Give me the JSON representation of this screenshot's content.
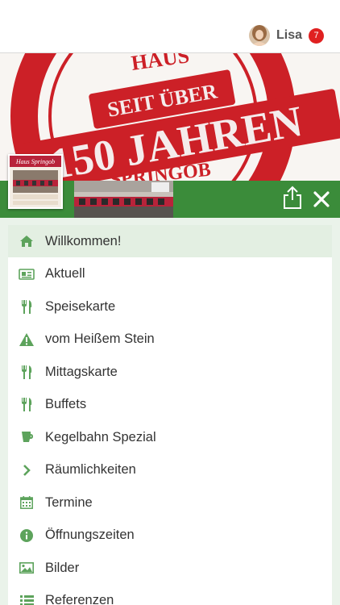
{
  "user": {
    "name": "Lisa",
    "notifications": "7"
  },
  "banner": {
    "line1": "SEIT ÜBER",
    "line2": "150 JAHREN",
    "top_text": "HAUS",
    "bottom_text": "SPRINGOB"
  },
  "logo": {
    "title": "Haus Springob",
    "caption": "Gemütlich, Alles im Spektakel mit Kegelbahn",
    "footer": "Haus Springob - seit über 150 Jahren"
  },
  "menu": {
    "items": [
      {
        "label": "Willkommen!",
        "icon": "home-icon",
        "active": true
      },
      {
        "label": "Aktuell",
        "icon": "newspaper-icon",
        "active": false
      },
      {
        "label": "Speisekarte",
        "icon": "cutlery-icon",
        "active": false
      },
      {
        "label": "vom Heißem Stein",
        "icon": "warning-icon",
        "active": false
      },
      {
        "label": "Mittagskarte",
        "icon": "cutlery-icon",
        "active": false
      },
      {
        "label": "Buffets",
        "icon": "cutlery-icon",
        "active": false
      },
      {
        "label": "Kegelbahn Spezial",
        "icon": "coffee-icon",
        "active": false
      },
      {
        "label": "Räumlichkeiten",
        "icon": "chevron-right-icon",
        "active": false
      },
      {
        "label": "Termine",
        "icon": "calendar-icon",
        "active": false
      },
      {
        "label": "Öffnungszeiten",
        "icon": "info-icon",
        "active": false
      },
      {
        "label": "Bilder",
        "icon": "image-icon",
        "active": false
      },
      {
        "label": "Referenzen",
        "icon": "list-icon",
        "active": false
      }
    ]
  },
  "colors": {
    "accent": "#3b8c3a",
    "icon": "#5da35c",
    "badge": "#e02020",
    "stamp": "#cc2027"
  }
}
